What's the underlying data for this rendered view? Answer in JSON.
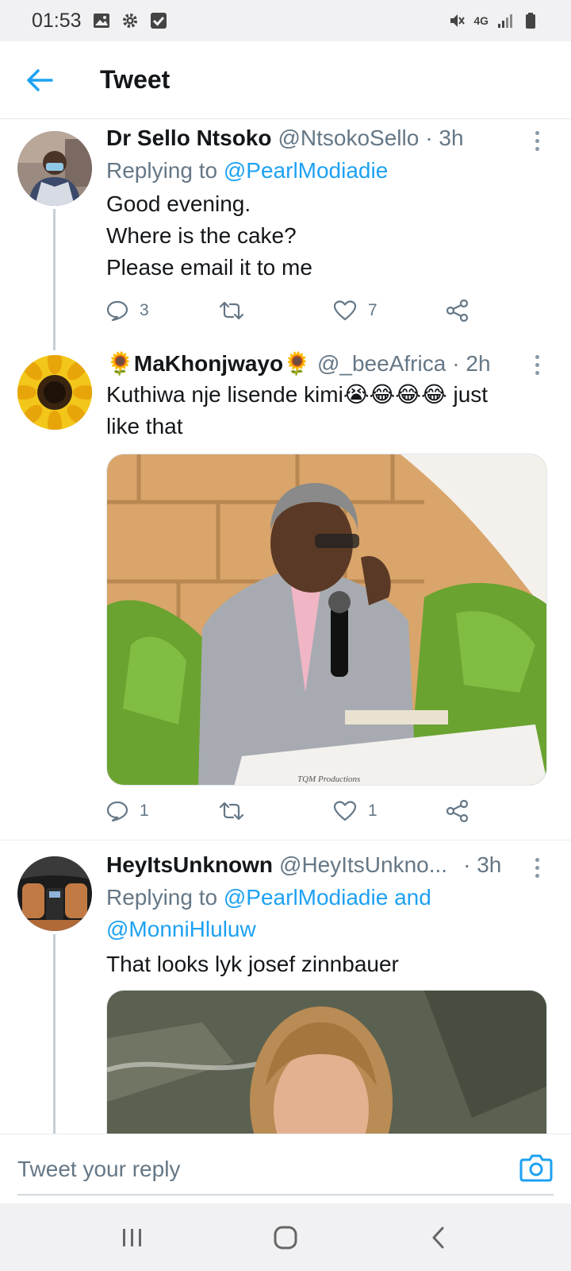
{
  "status_bar": {
    "time": "01:53",
    "network": "4G"
  },
  "header": {
    "title": "Tweet"
  },
  "tweets": [
    {
      "name": "Dr Sello Ntsoko",
      "handle": "@NtsokoSello",
      "time": "· 3h",
      "replying_prefix": "Replying to ",
      "replying_to": "@PearlModiadie",
      "lines": [
        "Good evening.",
        "Where is the cake?",
        "Please email it to me"
      ],
      "reply_count": "3",
      "retweet_count": "",
      "like_count": "7"
    },
    {
      "name": "MaKhonjwayo",
      "name_emoji": "🌻",
      "handle": "@_beeAfrica",
      "time": "· 2h",
      "text_part": "Kuthiwa nje lisende kimi",
      "text_emoji": "😭😂😂😂",
      "text_end": " just",
      "text_line2": "like that",
      "media_caption": "TQM Productions",
      "reply_count": "1",
      "retweet_count": "",
      "like_count": "1"
    },
    {
      "name": "HeyItsUnknown",
      "handle": "@HeyItsUnkno...",
      "time": "· 3h",
      "replying_prefix": "Replying to ",
      "replying_to": "@PearlModiadie and",
      "replying_to_2": "@MonniHluluw",
      "text": "That looks lyk josef zinnbauer"
    }
  ],
  "reply_bar": {
    "placeholder": "Tweet your reply"
  },
  "colors": {
    "accent": "#1da1f2",
    "secondary_text": "#657786",
    "primary_text": "#14171a",
    "divider": "#e6ecf0"
  }
}
